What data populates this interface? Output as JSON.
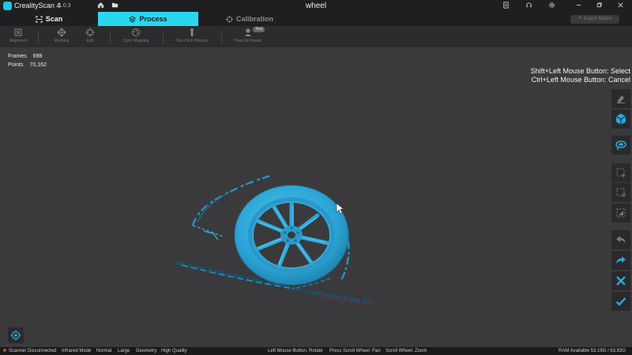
{
  "titlebar": {
    "app_name": "CrealityScan 4",
    "version": "1.0.3",
    "window_title": "wheel"
  },
  "modes": {
    "scan": "Scan",
    "process": "Process",
    "calibration": "Calibration",
    "export": "Export Model"
  },
  "toolbar": {
    "alignment": "Alignment",
    "meshing": "Meshing",
    "edit": "Edit",
    "color_mapping": "Color Mapping",
    "one_click": "One-Click Process",
    "head_repair": "Head AI Repair",
    "test_badge": "Test"
  },
  "stats": {
    "frames_label": "Frames",
    "frames_value": "698",
    "points_label": "Points",
    "points_value": "70,162"
  },
  "hints": {
    "select": "Shift+Left Mouse Button: Select",
    "cancel": "Ctrl+Left Mouse Button: Cancel"
  },
  "statusbar": {
    "scanner": "Scanner Disconnected",
    "infrared": "Infrared Mode",
    "normal": "Normal",
    "large": "Large",
    "geometry": "Geometry",
    "quality": "High Quality",
    "rotate": "Left Mouse Button: Rotate",
    "pan": "Press Scroll Wheel: Pan",
    "zoom": "Scroll Wheel: Zoom",
    "ram": "RAM Available 53.19G / 63.83G"
  },
  "colors": {
    "accent": "#28d7ee",
    "model": "#2aa8d8",
    "background": "#3a3a3c"
  }
}
